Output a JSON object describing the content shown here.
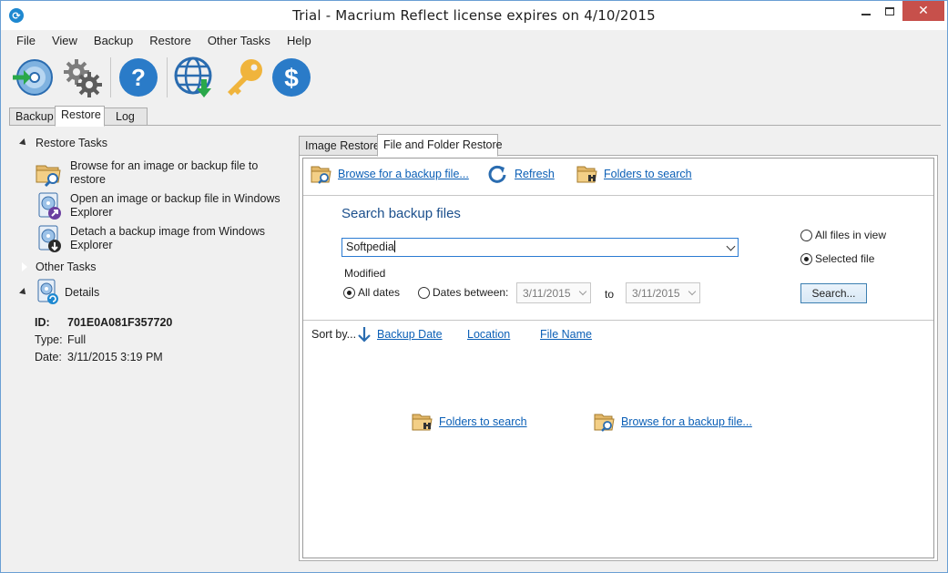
{
  "window": {
    "title": "Trial - Macrium Reflect  license expires on 4/10/2015",
    "close_glyph": "✕"
  },
  "menu": [
    "File",
    "View",
    "Backup",
    "Restore",
    "Other Tasks",
    "Help"
  ],
  "toolbar": {
    "buttons": [
      "restore-disc-icon",
      "settings-gears-icon",
      "help-icon",
      "web-update-icon",
      "license-key-icon",
      "buy-dollar-icon"
    ]
  },
  "top_tabs": [
    "Backup",
    "Restore",
    "Log"
  ],
  "left_panel": {
    "restore_tasks_label": "Restore Tasks",
    "tasks": [
      "Browse for an image or backup file to restore",
      "Open an image or backup file in Windows Explorer",
      "Detach a backup image from Windows Explorer"
    ],
    "other_tasks_label": "Other Tasks",
    "details_label": "Details",
    "details": {
      "id_label": "ID:",
      "id_value": "701E0A081F357720",
      "type_label": "Type:",
      "type_value": "Full",
      "date_label": "Date:",
      "date_value": "3/11/2015 3:19 PM"
    }
  },
  "right_tabs": [
    "Image Restore",
    "File and Folder Restore"
  ],
  "actions": {
    "browse": "Browse for a backup file...",
    "refresh": "Refresh",
    "folders": "Folders to search"
  },
  "search": {
    "title": "Search backup files",
    "value": "Softpedia",
    "modified_label": "Modified",
    "all_dates": "All dates",
    "dates_between": "Dates between:",
    "date_from": "3/11/2015",
    "to_label": "to",
    "date_to": "3/11/2015",
    "all_files": "All files in view",
    "selected_file": "Selected file",
    "search_button": "Search..."
  },
  "sort": {
    "label": "Sort by...",
    "backup_date": "Backup Date",
    "location": "Location",
    "file_name": "File Name"
  },
  "bottom_links": {
    "folders": "Folders to search",
    "browse": "Browse for a backup file..."
  },
  "colors": {
    "link": "#0b5fb6",
    "accent_blue": "#1e88d0",
    "close_red": "#c7504b"
  }
}
